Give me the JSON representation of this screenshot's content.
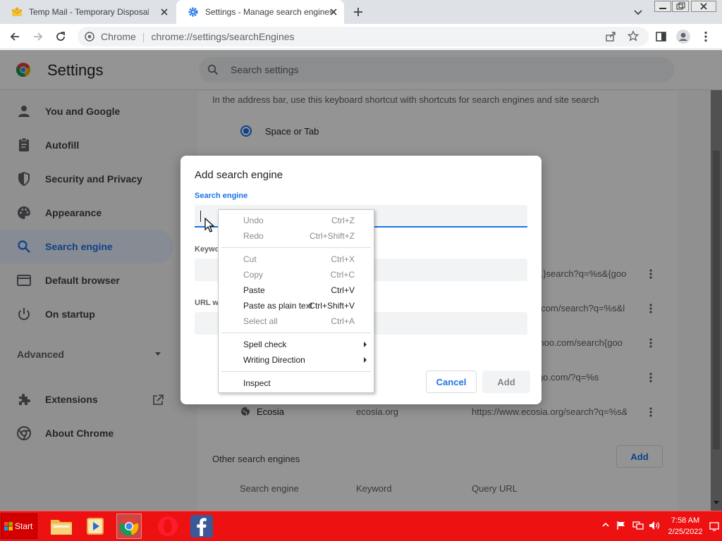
{
  "browser": {
    "tabs": [
      {
        "title": "Temp Mail - Temporary Disposable E",
        "active": false,
        "icon": "mail-icon"
      },
      {
        "title": "Settings - Manage search engines",
        "active": true,
        "icon": "gear-icon"
      }
    ],
    "omnibox": {
      "host": "Chrome",
      "url": "chrome://settings/searchEngines"
    }
  },
  "settings": {
    "title": "Settings",
    "search_placeholder": "Search settings",
    "nav": [
      {
        "label": "You and Google",
        "icon": "person-icon"
      },
      {
        "label": "Autofill",
        "icon": "clipboard-icon"
      },
      {
        "label": "Security and Privacy",
        "icon": "shield-icon"
      },
      {
        "label": "Appearance",
        "icon": "palette-icon"
      },
      {
        "label": "Search engine",
        "icon": "search-icon",
        "selected": true
      },
      {
        "label": "Default browser",
        "icon": "browser-icon"
      },
      {
        "label": "On startup",
        "icon": "power-icon"
      }
    ],
    "advanced_label": "Advanced",
    "extensions_label": "Extensions",
    "about_label": "About Chrome"
  },
  "content": {
    "shortcut_desc": "In the address bar, use this keyboard shortcut with shortcuts for search engines and site search",
    "radio_label": "Space or Tab",
    "engine_rows": [
      {
        "url": "{google:baseURL}search?q=%s&{goog"
      },
      {
        "url": "https://www.bing.com/search?q=%s&l"
      },
      {
        "url": "https://search.yahoo.com/search{goo"
      },
      {
        "url": "https://duckduckgo.com/?q=%s"
      },
      {
        "name": "Ecosia",
        "keyword": "ecosia.org",
        "url": "https://www.ecosia.org/search?q=%s&"
      }
    ],
    "other_title": "Other search engines",
    "add_label": "Add",
    "col_engine": "Search engine",
    "col_keyword": "Keyword",
    "col_url": "Query URL"
  },
  "dialog": {
    "title": "Add search engine",
    "field1_label": "Search engine",
    "field2_label": "Keywo",
    "field3_label": "URL wi",
    "cancel": "Cancel",
    "add": "Add"
  },
  "context_menu": {
    "undo": "Undo",
    "undo_key": "Ctrl+Z",
    "redo": "Redo",
    "redo_key": "Ctrl+Shift+Z",
    "cut": "Cut",
    "cut_key": "Ctrl+X",
    "copy": "Copy",
    "copy_key": "Ctrl+C",
    "paste": "Paste",
    "paste_key": "Ctrl+V",
    "paste_plain": "Paste as plain text",
    "paste_plain_key": "Ctrl+Shift+V",
    "select_all": "Select all",
    "select_all_key": "Ctrl+A",
    "spell": "Spell check",
    "writing": "Writing Direction",
    "inspect": "Inspect"
  },
  "taskbar": {
    "start": "Start",
    "time": "7:58 AM",
    "date": "2/25/2022",
    "apps": [
      "folder-icon",
      "media-player-icon",
      "chrome-icon",
      "opera-icon",
      "facebook-icon"
    ]
  },
  "colors": {
    "accent": "#1a73e8",
    "taskbar": "#ee1111"
  }
}
